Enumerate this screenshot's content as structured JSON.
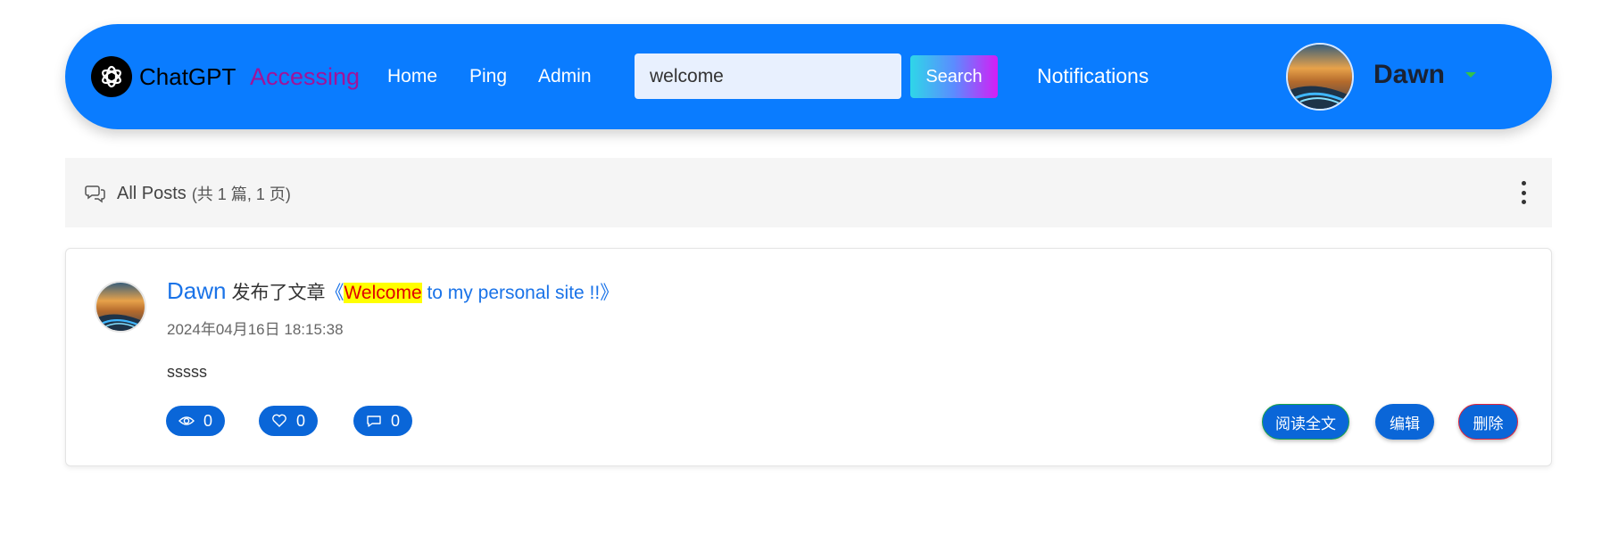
{
  "navbar": {
    "brand": "ChatGPT",
    "accessing": "Accessing",
    "links": [
      "Home",
      "Ping",
      "Admin"
    ],
    "search_value": "welcome",
    "search_button": "Search",
    "notifications": "Notifications",
    "user_name": "Dawn",
    "colors": {
      "bar": "#0a7cff",
      "accessing": "#a0139a",
      "caret": "#33c24a"
    }
  },
  "posts_bar": {
    "title": "All Posts",
    "count": "(共 1 篇, 1 页)",
    "icon": "chat-bubbles-icon",
    "more_icon": "more-vertical-icon"
  },
  "post": {
    "author": "Dawn",
    "verb": "发布了文章",
    "title_open": "《",
    "title_highlight": "Welcome",
    "title_rest": " to my personal site !!",
    "title_close": "》",
    "date": "2024年04月16日 18:15:38",
    "body": "sssss",
    "stats": {
      "views": "0",
      "likes": "0",
      "comments": "0"
    },
    "actions": {
      "read_full": "阅读全文",
      "edit": "编辑",
      "delete": "删除"
    }
  }
}
